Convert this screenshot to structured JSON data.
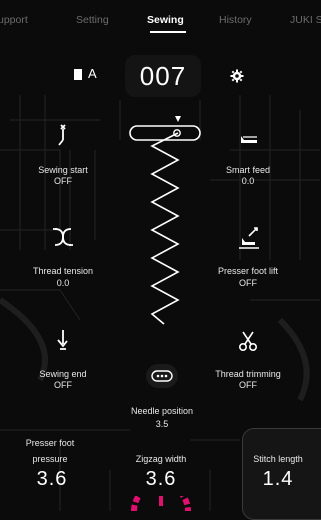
{
  "tabs": [
    {
      "label": "Support",
      "display": "upport"
    },
    {
      "label": "Setting",
      "display": "Setting"
    },
    {
      "label": "Sewing",
      "display": "Sewing"
    },
    {
      "label": "History",
      "display": "History"
    },
    {
      "label": "JUKI S",
      "display": "JUKI S"
    }
  ],
  "header": {
    "pattern_letter": "A",
    "pattern_number": "007"
  },
  "functions": {
    "sewing_start": {
      "label": "Sewing start",
      "value": "OFF"
    },
    "smart_feed": {
      "label": "Smart feed",
      "value": "0.0"
    },
    "thread_tension": {
      "label": "Thread tension",
      "value": "0.0"
    },
    "presser_foot_lift": {
      "label": "Presser foot lift",
      "value": "OFF"
    },
    "sewing_end": {
      "label": "Sewing end",
      "value": "OFF"
    },
    "thread_trimming": {
      "label": "Thread trimming",
      "value": "OFF"
    }
  },
  "needle_position": {
    "label": "Needle position",
    "value": "3.5"
  },
  "bottom": {
    "presser_foot_pressure": {
      "label_line1": "Presser foot",
      "label_line2": "pressure",
      "value": "3.6"
    },
    "zigzag_width": {
      "label": "Zigzag width",
      "value": "3.6"
    },
    "stitch_length": {
      "label": "Stitch length",
      "value": "1.4"
    }
  },
  "colors": {
    "background": "#0b0b0b",
    "text": "#ffffff",
    "inactive_tab": "#6c6c6c",
    "accent_magenta": "#e0106f"
  }
}
